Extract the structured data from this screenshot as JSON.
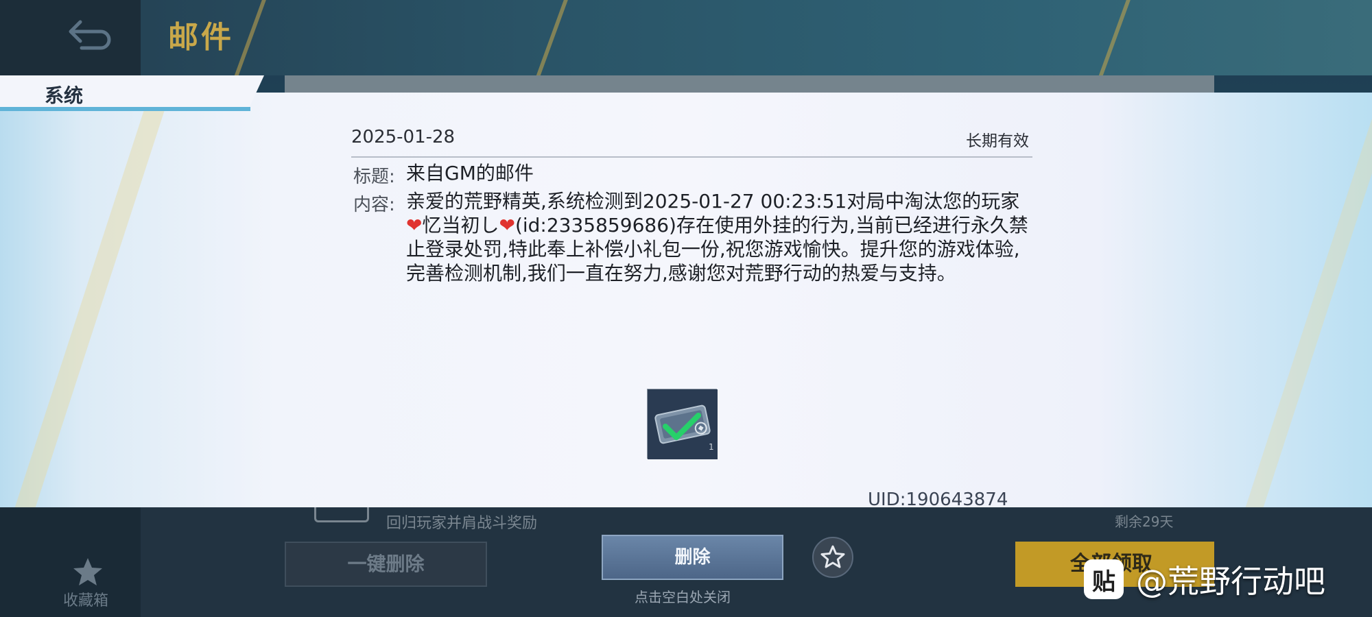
{
  "header": {
    "title": "邮件",
    "back_icon": "back-arrow-icon"
  },
  "tab": {
    "label": "系统"
  },
  "mail": {
    "date": "2025-01-28",
    "validity": "长期有效",
    "title_label": "标题:",
    "title": "来自GM的邮件",
    "content_label": "内容:",
    "content_part1": "亲爱的荒野精英,系统检测到2025-01-27 00:23:51对局中淘汰您的玩家",
    "heart": "❤",
    "player_name": "忆当初し",
    "content_part2": "(id:2335859686)存在使用外挂的行为,当前已经进行永久禁止登录处罚,特此奉上补偿小礼包一份,祝您游戏愉快。提升您的游戏体验,完善检测机制,我们一直在努力,感谢您对荒野行动的热爱与支持。",
    "attachment": {
      "icon": "ticket-card-icon",
      "count": "1"
    },
    "uid": "UID:190643874"
  },
  "background_list": {
    "peek_text": "回归玩家并肩战斗奖励",
    "peek_right": "剩余29天"
  },
  "footer": {
    "favorites_label": "收藏箱",
    "bulk_delete_label": "一键删除",
    "delete_label": "删除",
    "close_hint": "点击空白处关闭",
    "claim_all_label": "全部领取"
  },
  "watermark": {
    "logo_text": "贴",
    "text": "@荒野行动吧"
  },
  "colors": {
    "accent_gold": "#c29a26",
    "delete_blue": "#5a7596",
    "tab_accent": "#5fb3d8",
    "heart": "#e0332f"
  }
}
